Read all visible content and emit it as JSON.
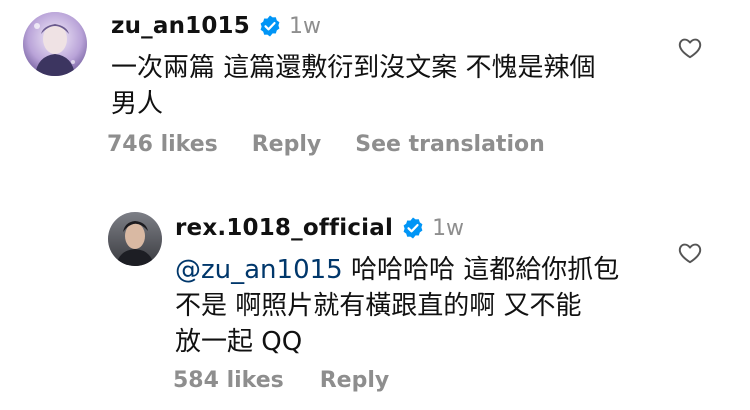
{
  "comments": [
    {
      "username": "zu_an1015",
      "time": "1w",
      "text_lines": [
        "一次兩篇 這篇還敷衍到沒文案 不愧是辣個",
        "男人"
      ],
      "likes": "746 likes",
      "reply_label": "Reply",
      "translation_label": "See translation",
      "avatar_icon": "avatar-purple-portrait",
      "verified_icon": "verified-badge-icon",
      "like_icon": "heart-outline-icon"
    },
    {
      "username": "rex.1018_official",
      "time": "1w",
      "mention": "@zu_an1015",
      "text_line1_rest": " 哈哈哈哈 這都給你抓包",
      "text_lines": [
        "不是 啊照片就有橫跟直的啊 又不能",
        "放一起 QQ"
      ],
      "likes": "584 likes",
      "reply_label": "Reply",
      "avatar_icon": "avatar-dark-portrait",
      "verified_icon": "verified-badge-icon",
      "like_icon": "heart-outline-icon"
    }
  ],
  "colors": {
    "verified": "#0095f6",
    "meta_text": "#8e8e8e",
    "mention": "#00376b",
    "primary_text": "#111111"
  }
}
